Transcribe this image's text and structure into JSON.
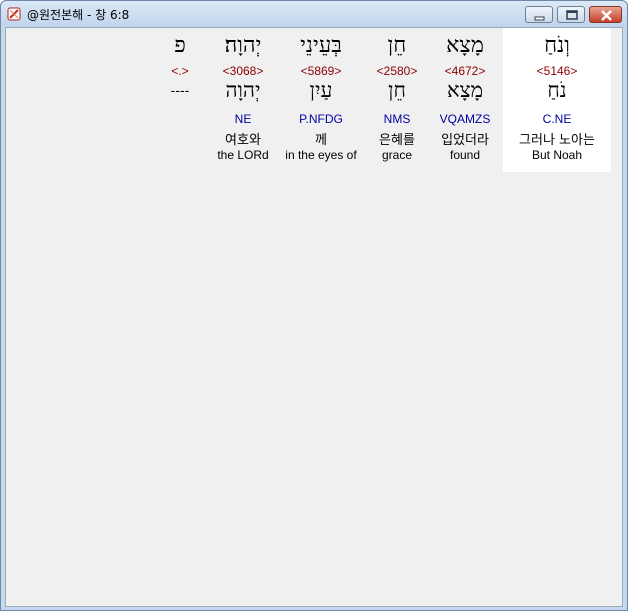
{
  "window": {
    "title": "@원전본해 - 창 6:8"
  },
  "columns": [
    {
      "hebrew": "וְנֹחַ",
      "strong": "<5146>",
      "lexeme": "נֹחַ",
      "morph": "C.NE",
      "korean": "그러나 노아는",
      "english": "But Noah",
      "highlighted": true
    },
    {
      "hebrew": "מָצָא",
      "strong": "<4672>",
      "lexeme": "מָצָא",
      "morph": "VQAMZS",
      "korean": "입었더라",
      "english": "found",
      "highlighted": false
    },
    {
      "hebrew": "חֵן",
      "strong": "<2580>",
      "lexeme": "חֵן",
      "morph": "NMS",
      "korean": "은혜를",
      "english": "grace",
      "highlighted": false
    },
    {
      "hebrew": "בְּעֵינֵי",
      "strong": "<5869>",
      "lexeme": "עַיִן",
      "morph": "P.NFDG",
      "korean": "께",
      "english": "in the eyes of",
      "highlighted": false
    },
    {
      "hebrew": "יְהוָה׃",
      "strong": "<3068>",
      "lexeme": "יְהוָה",
      "morph": "NE",
      "korean": "여호와",
      "english": "the LORd",
      "highlighted": false
    },
    {
      "hebrew": "פ",
      "strong": "<.>",
      "lexeme": "----",
      "morph": "",
      "korean": "",
      "english": "",
      "highlighted": false
    }
  ],
  "icons": {
    "app": "bible-app-icon",
    "minimize": "minimize-icon",
    "maximize": "maximize-icon",
    "close": "close-icon"
  }
}
